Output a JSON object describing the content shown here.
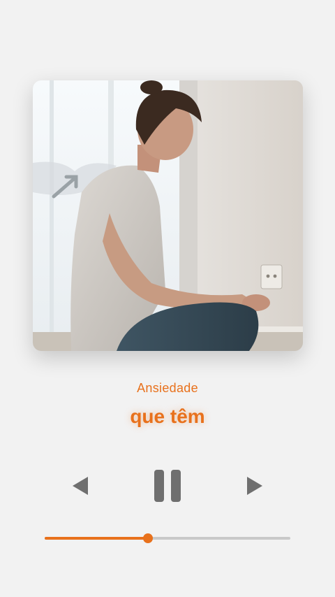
{
  "player": {
    "subtitle": "Ansiedade",
    "title": "que têm",
    "progress_fraction": 0.42,
    "accent_color": "#e8711c",
    "control_color": "#6f6f6f"
  },
  "artwork": {
    "description_icon": "album-art-image"
  },
  "controls": {
    "prev_icon": "previous-icon",
    "pause_icon": "pause-icon",
    "next_icon": "next-icon"
  }
}
